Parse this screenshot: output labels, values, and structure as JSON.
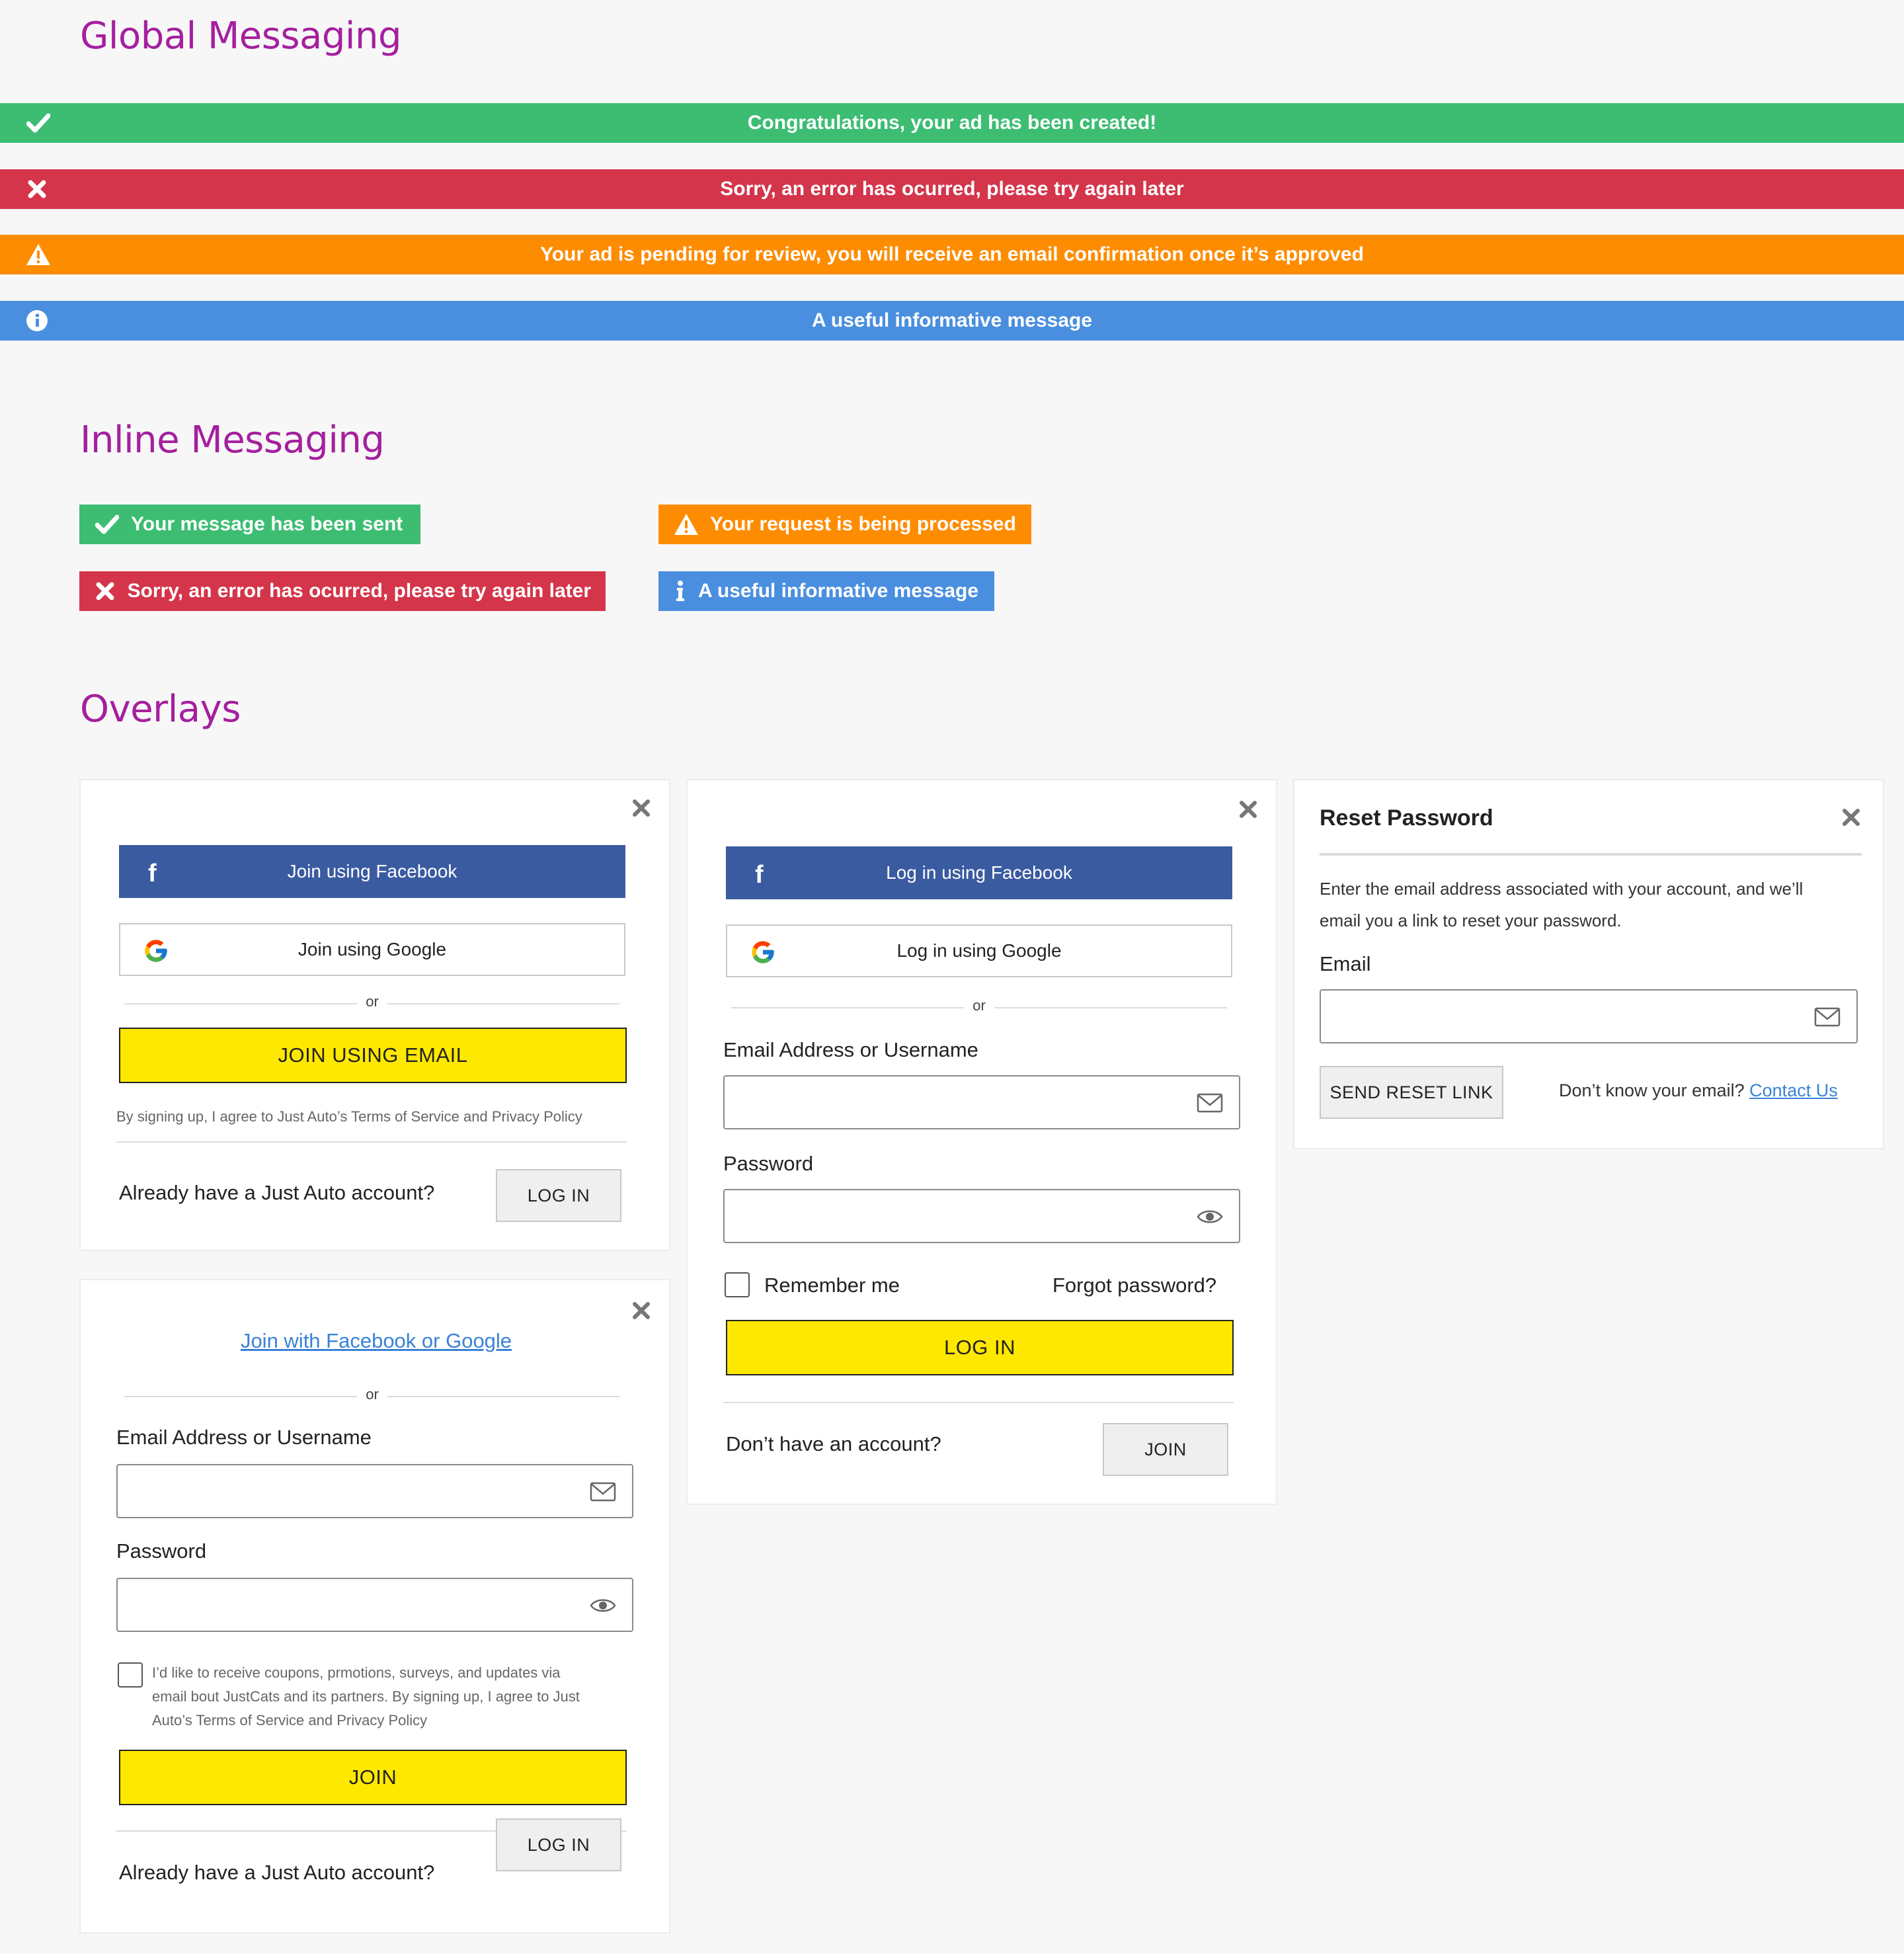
{
  "sections": {
    "global": "Global Messaging",
    "inline": "Inline Messaging",
    "overlays": "Overlays"
  },
  "global_messages": {
    "success": "Congratulations, your ad has been created!",
    "error": "Sorry, an error has ocurred, please try again later",
    "warning": "Your ad is pending for review, you will receive an email confirmation once it’s approved",
    "info": "A useful informative message"
  },
  "inline_messages": {
    "success": "Your message has been sent",
    "warning": "Your request is being processed",
    "error": "Sorry, an error has ocurred, please try again later",
    "info": "A useful informative message"
  },
  "join_card": {
    "facebook": "Join using Facebook",
    "google": "Join using Google",
    "or": "or",
    "email_btn": "JOIN USING EMAIL",
    "terms": "By signing up, I agree to Just Auto’s Terms of Service and Privacy Policy",
    "already": "Already have a Just Auto account?",
    "login_btn": "LOG IN"
  },
  "join_email_card": {
    "social_link": "Join with Facebook or Google",
    "or": "or",
    "email_label": "Email Address or Username",
    "email_value": "",
    "password_label": "Password",
    "password_value": "",
    "consent_line1": "I’d like to receive coupons, prmotions, surveys, and updates via",
    "consent_line2": "email bout JustCats and its partners. By signing up, I agree to Just",
    "consent_line3": "Auto’s Terms of Service and Privacy Policy",
    "join_btn": "JOIN",
    "already": "Already have a Just Auto account?",
    "login_btn": "LOG IN"
  },
  "login_card": {
    "facebook": "Log in using Facebook",
    "google": "Log in using Google",
    "or": "or",
    "email_label": "Email Address or Username",
    "email_value": "",
    "password_label": "Password",
    "password_value": "",
    "remember": "Remember me",
    "forgot": "Forgot password?",
    "login_btn": "LOG IN",
    "no_account": "Don’t have an account?",
    "join_btn": "JOIN"
  },
  "reset_card": {
    "title": "Reset Password",
    "desc_line1": "Enter the email address associated with your account, and we’ll",
    "desc_line2": "email you a link to reset your password.",
    "email_label": "Email",
    "email_value": "",
    "send_btn": "SEND RESET LINK",
    "dont_know": "Don’t know your email?",
    "contact": "Contact Us"
  },
  "colors": {
    "success": "#3cbd72",
    "error": "#d4354a",
    "warning": "#fe8c00",
    "info": "#4a8fdf",
    "heading": "#a4209e",
    "facebook": "#3a5ba0",
    "primary_button": "#ffe800"
  },
  "icons": [
    "check-icon",
    "x-icon",
    "warning-icon",
    "info-icon",
    "close-icon",
    "facebook-icon",
    "google-icon",
    "envelope-icon",
    "eye-icon"
  ]
}
